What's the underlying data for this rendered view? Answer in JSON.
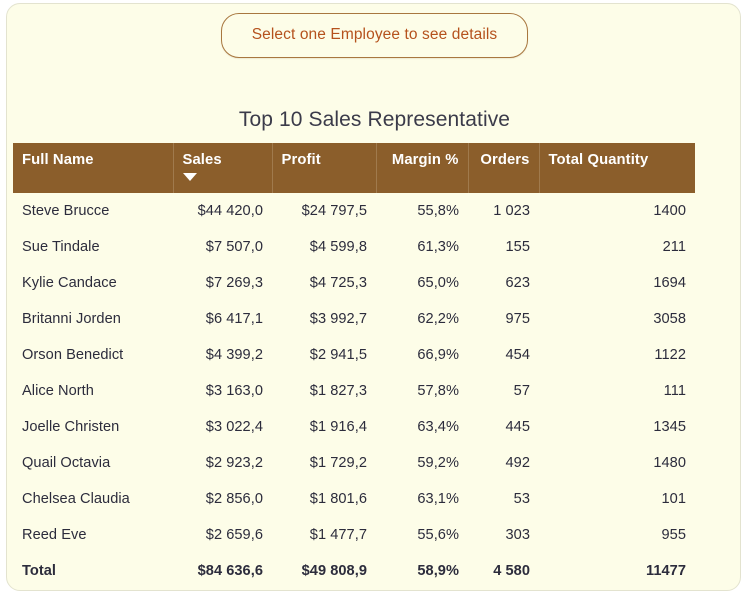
{
  "prompt": {
    "label": "Select one Employee to see details"
  },
  "table": {
    "title": "Top 10 Sales Representative",
    "sort_column": "Sales",
    "sort_direction": "descending",
    "colors": {
      "header_background": "#8b5e2b",
      "header_text": "#ffffff",
      "card_background": "#fdfde8",
      "prompt_text": "#b5521d",
      "prompt_border": "#a8773f",
      "body_text": "#2c2c3c"
    },
    "columns": [
      {
        "label": "Full Name",
        "align": "left"
      },
      {
        "label": "Sales",
        "align": "right"
      },
      {
        "label": "Profit",
        "align": "right"
      },
      {
        "label": "Margin %",
        "align": "right"
      },
      {
        "label": "Orders",
        "align": "right"
      },
      {
        "label": "Total Quantity",
        "align": "right"
      }
    ],
    "rows": [
      {
        "name": "Steve Brucce",
        "sales": "$44 420,0",
        "profit": "$24 797,5",
        "margin": "55,8%",
        "orders": "1 023",
        "quantity": "1400"
      },
      {
        "name": "Sue Tindale",
        "sales": "$7 507,0",
        "profit": "$4 599,8",
        "margin": "61,3%",
        "orders": "155",
        "quantity": "211"
      },
      {
        "name": "Kylie Candace",
        "sales": "$7 269,3",
        "profit": "$4 725,3",
        "margin": "65,0%",
        "orders": "623",
        "quantity": "1694"
      },
      {
        "name": "Britanni Jorden",
        "sales": "$6 417,1",
        "profit": "$3 992,7",
        "margin": "62,2%",
        "orders": "975",
        "quantity": "3058"
      },
      {
        "name": "Orson Benedict",
        "sales": "$4 399,2",
        "profit": "$2 941,5",
        "margin": "66,9%",
        "orders": "454",
        "quantity": "1122"
      },
      {
        "name": "Alice North",
        "sales": "$3 163,0",
        "profit": "$1 827,3",
        "margin": "57,8%",
        "orders": "57",
        "quantity": "111"
      },
      {
        "name": "Joelle Christen",
        "sales": "$3 022,4",
        "profit": "$1 916,4",
        "margin": "63,4%",
        "orders": "445",
        "quantity": "1345"
      },
      {
        "name": "Quail Octavia",
        "sales": "$2 923,2",
        "profit": "$1 729,2",
        "margin": "59,2%",
        "orders": "492",
        "quantity": "1480"
      },
      {
        "name": "Chelsea Claudia",
        "sales": "$2 856,0",
        "profit": "$1 801,6",
        "margin": "63,1%",
        "orders": "53",
        "quantity": "101"
      },
      {
        "name": "Reed Eve",
        "sales": "$2 659,6",
        "profit": "$1 477,7",
        "margin": "55,6%",
        "orders": "303",
        "quantity": "955"
      }
    ],
    "total": {
      "name": "Total",
      "sales": "$84 636,6",
      "profit": "$49 808,9",
      "margin": "58,9%",
      "orders": "4 580",
      "quantity": "11477"
    }
  }
}
